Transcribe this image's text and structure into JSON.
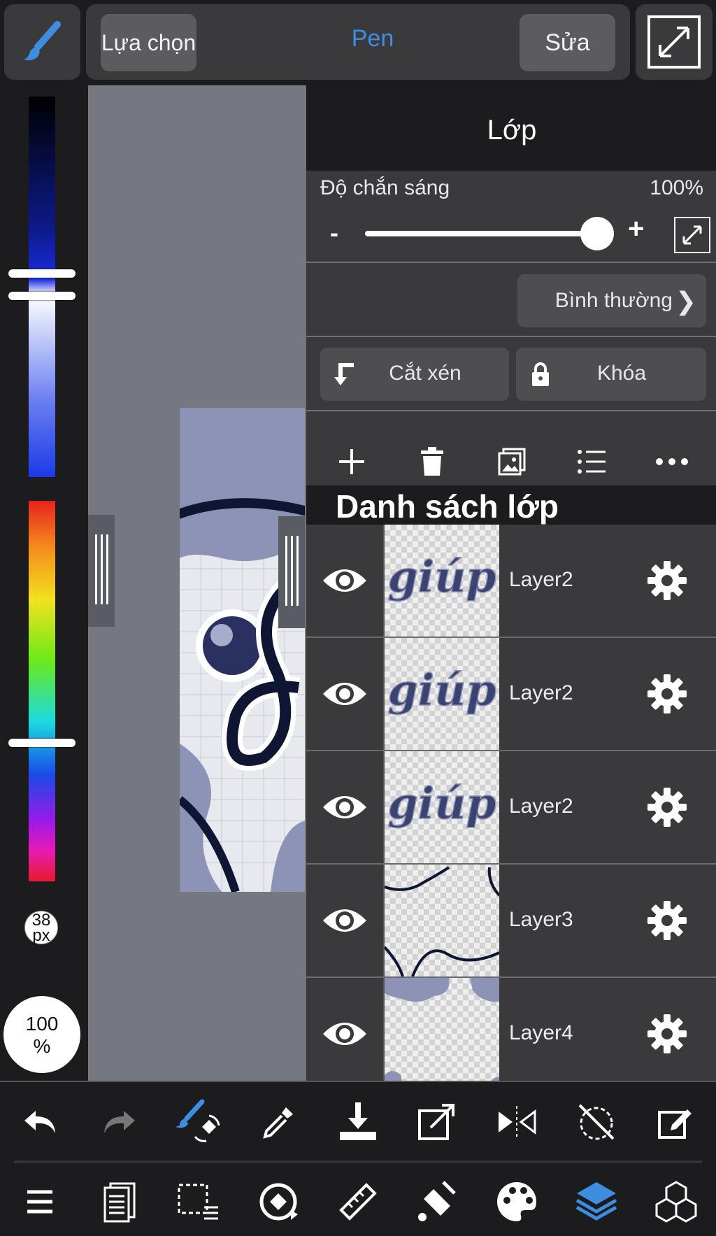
{
  "topbar": {
    "selection_label": "Lựa chọn",
    "tool_name": "Pen",
    "edit_label": "Sửa"
  },
  "left": {
    "brush_size": "38",
    "brush_unit": "px",
    "opacity_value": "100",
    "opacity_unit": "%"
  },
  "colors": {
    "accent": "#3d8ee0",
    "panel_bg": "#3a3a3c",
    "bar_bg": "#1c1c1e",
    "art_navy": "#0f1633",
    "art_lavender": "#8c93b6"
  },
  "layer_panel": {
    "title": "Lớp",
    "opacity_label": "Độ chắn sáng",
    "opacity_value": "100%",
    "minus": "-",
    "plus": "+",
    "blend_mode": "Bình thường",
    "clip_label": "Cắt xén",
    "lock_label": "Khóa",
    "list_title": "Danh sách lớp",
    "tools": [
      "plus-icon",
      "trash-icon",
      "image-icon",
      "list-icon",
      "more-icon"
    ],
    "layers": [
      {
        "name": "Layer2",
        "visible": true,
        "thumb": "giup-text"
      },
      {
        "name": "Layer2",
        "visible": true,
        "thumb": "giup-text"
      },
      {
        "name": "Layer2",
        "visible": true,
        "thumb": "giup-text"
      },
      {
        "name": "Layer3",
        "visible": true,
        "thumb": "wavy-lines"
      },
      {
        "name": "Layer4",
        "visible": true,
        "thumb": "blobs"
      }
    ]
  },
  "bottom_row1": [
    "undo-icon",
    "redo-icon",
    "brush-transform-icon",
    "eyedropper-icon",
    "fill-download-icon",
    "transform-icon",
    "flip-icon",
    "rotate-off-icon",
    "edit-icon"
  ],
  "bottom_row2": [
    "menu-icon",
    "pages-icon",
    "selection-icon",
    "snap-icon",
    "ruler-icon",
    "fill-icon",
    "palette-icon",
    "layers-icon",
    "materials-icon"
  ]
}
